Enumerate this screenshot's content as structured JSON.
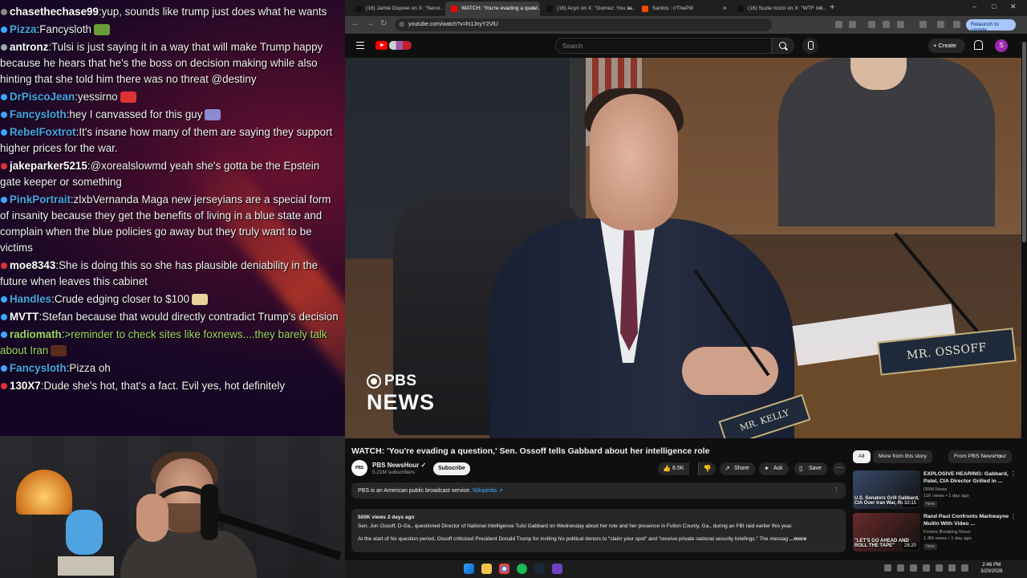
{
  "chat": {
    "messages": [
      {
        "badge_color": "#888888",
        "user": "chasethechase99",
        "user_color": "#ffffff",
        "text": "yup, sounds like trump just does what he wants",
        "text_color": "#f2f2f2"
      },
      {
        "badge_color": "#3ea6ff",
        "user": "Pizza",
        "user_color": "#45a7e6",
        "text": "Fancysloth",
        "text_color": "#f2f2f2",
        "emote_color": "#6b9c3a"
      },
      {
        "badge_color": "#9aa",
        "user": "antronz",
        "user_color": "#ffffff",
        "text": "Tulsi is just saying it in a way that will make Trump happy because he hears that he's the boss on decision making while also hinting that she told him there was no threat @destiny",
        "text_color": "#f2f2f2"
      },
      {
        "badge_color": "#3ea6ff",
        "user": "DrPiscoJean",
        "user_color": "#45a7e6",
        "text": "yessirno",
        "text_color": "#f2f2f2",
        "emote_color": "#d33"
      },
      {
        "badge_color": "#3ea6ff",
        "user": "Fancysloth",
        "user_color": "#45a7e6",
        "text": "hey I canvassed for this guy",
        "text_color": "#f2f2f2",
        "emote_color": "#8a8ad0"
      },
      {
        "badge_color": "#3ea6ff",
        "user": "RebelFoxtrot",
        "user_color": "#45a7e6",
        "text": "It's insane how many of them are saying they support higher prices for the war.",
        "text_color": "#f2f2f2"
      },
      {
        "badge_color": "#e0303a",
        "user": "jakeparker5215",
        "user_color": "#ffffff",
        "text": "@xorealslowmd yeah she's gotta be the Epstein gate keeper or something",
        "text_color": "#f2f2f2"
      },
      {
        "badge_color": "#3ea6ff",
        "user": "PinkPortrait",
        "user_color": "#45a7e6",
        "text": "zlxbVernanda Maga new jerseyians are a special form of insanity because they get the benefits of living in a blue state and complain when the blue policies go away but they truly want to be victims",
        "text_color": "#f2f2f2"
      },
      {
        "badge_color": "#e0303a",
        "user": "moe8343",
        "user_color": "#ffffff",
        "text": "She is doing this so she has plausible deniability in the future when leaves this cabinet",
        "text_color": "#f2f2f2"
      },
      {
        "badge_color": "#3ea6ff",
        "user": "Handles",
        "user_color": "#45a7e6",
        "text": "Crude edging closer to $100",
        "text_color": "#f2f2f2",
        "emote_color": "#e8d39a"
      },
      {
        "badge_color": "#3ea6ff",
        "user": "MVTT",
        "user_color": "#ffffff",
        "text": "Stefan because that would directly contradict Trump's decision",
        "text_color": "#f2f2f2"
      },
      {
        "badge_color": "#3ea6ff",
        "user": "radiomath",
        "user_color": "#9fd860",
        "text": ">reminder to check sites like foxnews....they barely talk about Iran",
        "text_color": "#9fd860",
        "emote_color": "#5a2a1a"
      },
      {
        "badge_color": "#3ea6ff",
        "user": "Fancysloth",
        "user_color": "#45a7e6",
        "text": "Pizza oh",
        "text_color": "#f2f2f2"
      },
      {
        "badge_color": "#e0303a",
        "user": "130X7",
        "user_color": "#ffffff",
        "text": "Dude she's hot, that's a fact. Evil yes, hot definitely",
        "text_color": "#f2f2f2"
      }
    ]
  },
  "browser": {
    "tabs": [
      {
        "label": "(16) Jamie Dupree on X: \"Sen. ...",
        "favicon_color": "#111111",
        "active": false
      },
      {
        "label": "WATCH: 'You're evading a quest...",
        "favicon_color": "#ff0000",
        "active": true
      },
      {
        "label": "(16) Acyn on X: \"Gomez: You sa...",
        "favicon_color": "#111111",
        "active": false
      },
      {
        "label": "Santos : r/ThePitt",
        "favicon_color": "#ff4500",
        "active": false
      },
      {
        "label": "(16) Suzie rizzio on X: \"WTF is I...",
        "favicon_color": "#111111",
        "active": false
      }
    ],
    "new_tab": "+",
    "window_controls": {
      "minimize": "–",
      "maximize": "□",
      "close": "✕"
    },
    "url": "youtube.com/watch?v=hi1JnyY2VlU",
    "relaunch_label": "Relaunch to update",
    "nav": {
      "back": "←",
      "forward": "→",
      "reload": "↻"
    }
  },
  "youtube": {
    "search_placeholder": "Search",
    "create_label": "+ Create",
    "profile_letter": "S",
    "video": {
      "watermark_top": "PBS",
      "watermark_bottom": "NEWS",
      "nameplate_main": "MR. OSSOFF",
      "nameplate_second": "MR. KELLY"
    },
    "title": "WATCH: 'You're evading a question,' Sen. Ossoff tells Gabbard about her intelligence role",
    "channel": {
      "avatar_text": "PBS NEWS",
      "name": "PBS NewsHour ✓",
      "subs": "5.21M subscribers"
    },
    "subscribe_label": "Subscribe",
    "actions": {
      "likes": "8.5K",
      "like_icon": "👍",
      "dislike_icon": "👎",
      "share": "Share",
      "share_icon": "↗",
      "ask": "Ask",
      "ask_icon": "✦",
      "save": "Save",
      "save_icon": "▯",
      "more": "···"
    },
    "info_card": {
      "text": "PBS is an American public broadcast service.",
      "link": "Wikipedia ↗"
    },
    "description": {
      "meta": "500K views  2 days ago",
      "line1": "Sen. Jon Ossoff, D-Ga., questioned Director of National Intelligence Tulsi Gabbard on Wednesday about her role and her presence in Fulton County, Ga., during an FBI raid earlier this year.",
      "line2": "At the start of his question period, Ossoff criticized President Donald Trump for inviting his political donors to \"claim your spot\" and \"receive private national security briefings.\" The messag",
      "more": "...more"
    },
    "chips": [
      "All",
      "More from this story",
      "From PBS NewsHour"
    ],
    "recommendations": [
      {
        "title": "EXPLOSIVE HEARING: Gabbard, Patel, CIA Director Grilled in ...",
        "channel": "DRM News",
        "views": "11K views • 1 day ago",
        "badge": "New",
        "duration": "32:15",
        "thumb_text": "U.S. Senators Grill Gabbard, CIA Over Iran War, Russia...",
        "thumb_color": "#3a4a6a"
      },
      {
        "title": "Rand Paul Confronts Markwayne Mullin With Video ...",
        "channel": "Forbes Breaking News",
        "views": "1.3M views • 1 day ago",
        "badge": "New",
        "duration": "28:20",
        "thumb_text": "\"LET'S GO AHEAD AND ROLL THE TAPE\"",
        "thumb_color": "#6a2a2a"
      }
    ]
  },
  "taskbar": {
    "time": "2:46 PM",
    "date": "3/20/2026"
  }
}
